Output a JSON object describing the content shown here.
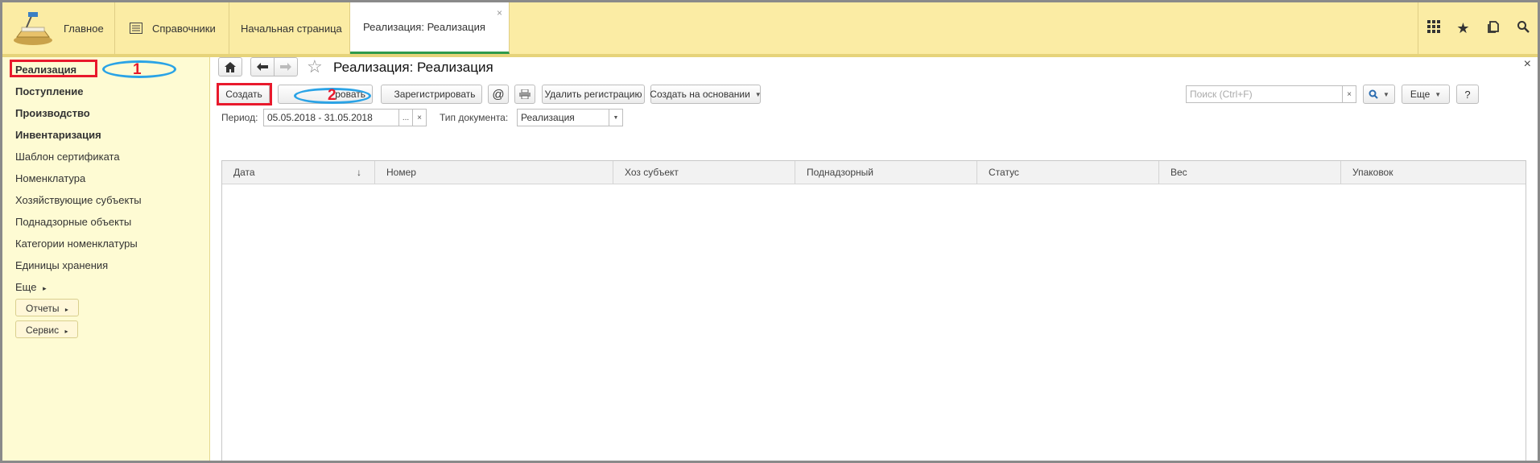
{
  "topbar": {
    "main_label": "Главное",
    "refs_label": "Справочники",
    "tabs": [
      {
        "label": "Начальная страница"
      },
      {
        "label": "Реализация: Реализация",
        "close": "×"
      }
    ],
    "icons": [
      "apps-grid-icon",
      "star-icon",
      "history-icon",
      "search-icon"
    ]
  },
  "sidebar": {
    "items": [
      {
        "label": "Реализация",
        "bold": true
      },
      {
        "label": "Поступление",
        "bold": true
      },
      {
        "label": "Производство",
        "bold": true
      },
      {
        "label": "Инвентаризация",
        "bold": true
      },
      {
        "label": "Шаблон сертификата"
      },
      {
        "label": "Номенклатура"
      },
      {
        "label": "Хозяйствующие субъекты"
      },
      {
        "label": "Поднадзорные объекты"
      },
      {
        "label": "Категории номенклатуры"
      },
      {
        "label": "Единицы хранения"
      },
      {
        "label": "Еще"
      }
    ],
    "more_caret": "▸",
    "buttons": [
      {
        "label": "Отчеты"
      },
      {
        "label": "Сервис"
      }
    ]
  },
  "main": {
    "title": "Реализация: Реализация",
    "close": "×",
    "toolbar": {
      "create": "Создать",
      "copy_partial": "ровать",
      "register": "Зарегистрировать",
      "at": "@",
      "unregister": "Удалить регистрацию",
      "create_based": "Создать на основании",
      "search_placeholder": "Поиск (Ctrl+F)",
      "search_clear": "×",
      "more": "Еще",
      "help": "?"
    },
    "filters": {
      "period_label": "Период:",
      "period_value": "05.05.2018 - 31.05.2018",
      "period_pick": "...",
      "period_clear": "×",
      "doctype_label": "Тип документа:",
      "doctype_value": "Реализация"
    },
    "table": {
      "columns": [
        "Дата",
        "Номер",
        "Хоз субъект",
        "Поднадзорный",
        "Статус",
        "Вес",
        "Упаковок"
      ],
      "sort_indicator": "↓",
      "rows": []
    }
  },
  "annotations": {
    "num1": "1",
    "num2": "2"
  },
  "colors": {
    "topbar": "#fbeca4",
    "sidebar": "#fefbd3",
    "accent_tab": "#2e9a4c",
    "annotation_red": "#e8192c",
    "annotation_blue": "#2aa3e6"
  }
}
